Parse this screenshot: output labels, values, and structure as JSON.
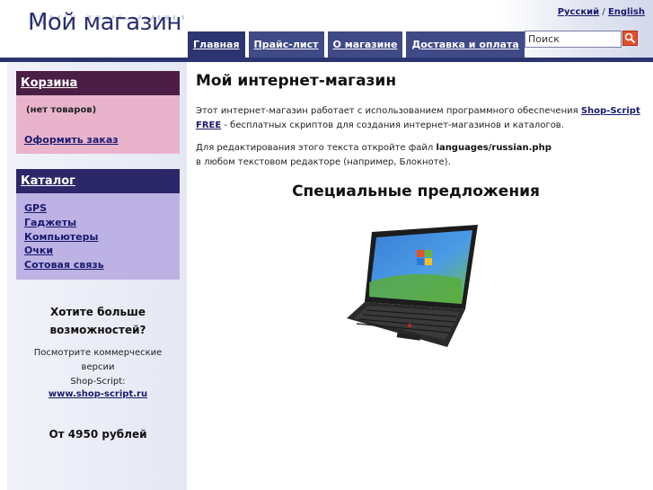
{
  "header": {
    "logo": "Мой магазин",
    "languages": [
      "Русский",
      "English"
    ],
    "lang_separator": "/",
    "nav_tabs": [
      "Главная",
      "Прайс-лист",
      "О магазине",
      "Доставка и оплата"
    ],
    "search_placeholder": "Поиск"
  },
  "cart": {
    "title": "Корзина",
    "empty_text": "(нет товаров)",
    "checkout_link": "Оформить заказ"
  },
  "catalog": {
    "title": "Каталог",
    "items": [
      "GPS",
      "Гаджеты",
      "Компьютеры",
      "Очки",
      "Сотовая связь"
    ]
  },
  "promo": {
    "title_line1": "Хотите больше",
    "title_line2": "возможностей?",
    "text_line1": "Посмотрите коммерческие версии",
    "text_line2": "Shop-Script:",
    "link": "www.shop-script.ru",
    "price": "От 4950 рублей"
  },
  "main": {
    "title": "Мой интернет-магазин",
    "p1_before": "Этот интернет-магазин работает с использованием программного обеспечения ",
    "p1_link_line1": "Shop-Script",
    "p1_link_line2": "FREE",
    "p1_after": " - бесплатных скриптов для создания интернет-магазинов и каталогов.",
    "p2_before": "Для редактирования этого текста откройте файл ",
    "p2_file": "languages/russian.php",
    "p2_after": "в любом текстовом редакторе (например, Блокноте).",
    "special_title": "Специальные предложения"
  },
  "colors": {
    "nav_tab": "#3f4a86",
    "top_bar": "#2c3570",
    "cart_head": "#4b1f45",
    "cart_body": "#e9b3cc",
    "catalog_head": "#2c2768",
    "catalog_body": "#bdb2e4",
    "search_button": "#e0502a",
    "link": "#1a1a6e"
  },
  "icons": {
    "search": "magnifier-icon",
    "product": "laptop-image"
  }
}
